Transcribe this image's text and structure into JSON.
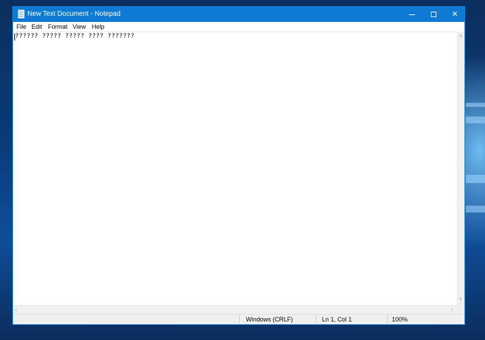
{
  "window": {
    "title": "New Text Document - Notepad",
    "icon": "notepad-icon",
    "accent_color": "#0f7ad6",
    "controls": {
      "minimize": "minimize-icon",
      "maximize": "maximize-icon",
      "close": "close-icon",
      "close_glyph": "✕"
    }
  },
  "menu": {
    "items": [
      {
        "label": "File"
      },
      {
        "label": "Edit"
      },
      {
        "label": "Format"
      },
      {
        "label": "View"
      },
      {
        "label": "Help"
      }
    ]
  },
  "editor": {
    "content": "?????? ????? ????? ???? ???????"
  },
  "scrollbars": {
    "up_arrow": "˄",
    "down_arrow": "˅",
    "left_arrow": "‹",
    "right_arrow": "›"
  },
  "statusbar": {
    "line_ending": "Windows (CRLF)",
    "position": "Ln 1, Col 1",
    "zoom": "100%"
  }
}
